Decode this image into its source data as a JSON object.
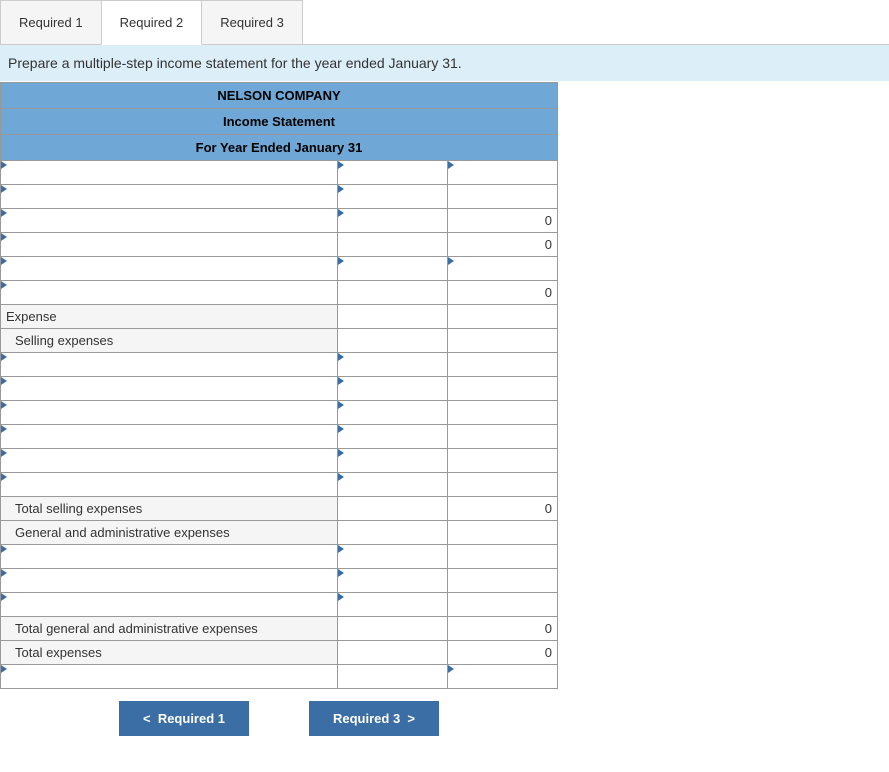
{
  "tabs": {
    "t1": "Required 1",
    "t2": "Required 2",
    "t3": "Required 3"
  },
  "instruction": "Prepare a multiple-step income statement for the year ended January 31.",
  "header": {
    "company": "NELSON COMPANY",
    "title": "Income Statement",
    "period": "For Year Ended January 31"
  },
  "labels": {
    "expense": "Expense",
    "selling": "Selling expenses",
    "total_selling": "Total selling expenses",
    "ga": "General and administrative expenses",
    "total_ga": "Total general and administrative expenses",
    "total_exp": "Total expenses"
  },
  "values": {
    "zero": "0"
  },
  "nav": {
    "prev": "Required 1",
    "next": "Required 3"
  }
}
